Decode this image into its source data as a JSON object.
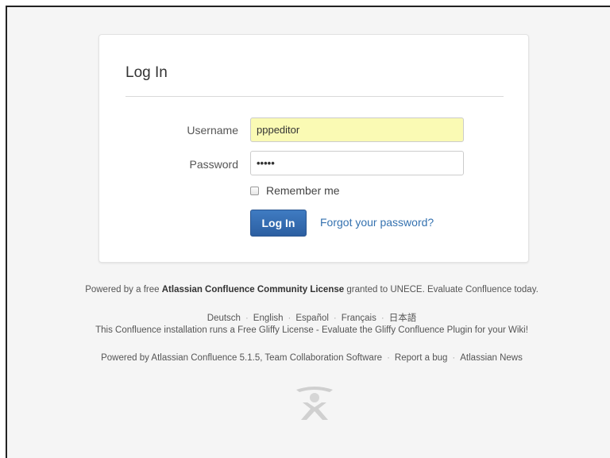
{
  "login": {
    "title": "Log In",
    "username_label": "Username",
    "username_value": "pppeditor",
    "password_label": "Password",
    "password_value": "•••••",
    "remember_label": "Remember me",
    "login_button": "Log In",
    "forgot_link": "Forgot your password?"
  },
  "footer": {
    "license_prefix": "Powered by a free",
    "license_bold": "Atlassian Confluence Community License",
    "license_suffix": "granted to UNECE. Evaluate Confluence today.",
    "languages": [
      "Deutsch",
      "English",
      "Español",
      "Français",
      "日本語"
    ],
    "gliffy_notice": "This Confluence installation runs a Free Gliffy License - Evaluate the Gliffy Confluence Plugin for your Wiki!",
    "powered_by": "Powered by Atlassian Confluence 5.1.5, Team Collaboration Software",
    "report_bug": "Report a bug",
    "atlassian_news": "Atlassian News"
  },
  "icons": {
    "logo": "atlassian-logo-icon",
    "checkbox": "checkbox-icon"
  },
  "colors": {
    "button": "#2c5fa1",
    "link": "#3572b0",
    "autofill": "#fafab4"
  }
}
